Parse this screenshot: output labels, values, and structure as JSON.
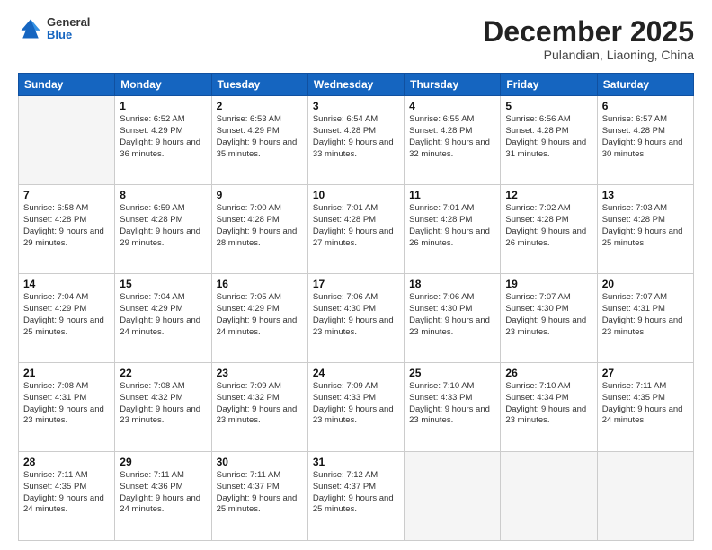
{
  "logo": {
    "general": "General",
    "blue": "Blue"
  },
  "header": {
    "month": "December 2025",
    "location": "Pulandian, Liaoning, China"
  },
  "days_of_week": [
    "Sunday",
    "Monday",
    "Tuesday",
    "Wednesday",
    "Thursday",
    "Friday",
    "Saturday"
  ],
  "weeks": [
    [
      {
        "day": "",
        "empty": true
      },
      {
        "day": "1",
        "sunrise": "6:52 AM",
        "sunset": "4:29 PM",
        "daylight": "9 hours and 36 minutes."
      },
      {
        "day": "2",
        "sunrise": "6:53 AM",
        "sunset": "4:29 PM",
        "daylight": "9 hours and 35 minutes."
      },
      {
        "day": "3",
        "sunrise": "6:54 AM",
        "sunset": "4:28 PM",
        "daylight": "9 hours and 33 minutes."
      },
      {
        "day": "4",
        "sunrise": "6:55 AM",
        "sunset": "4:28 PM",
        "daylight": "9 hours and 32 minutes."
      },
      {
        "day": "5",
        "sunrise": "6:56 AM",
        "sunset": "4:28 PM",
        "daylight": "9 hours and 31 minutes."
      },
      {
        "day": "6",
        "sunrise": "6:57 AM",
        "sunset": "4:28 PM",
        "daylight": "9 hours and 30 minutes."
      }
    ],
    [
      {
        "day": "7",
        "sunrise": "6:58 AM",
        "sunset": "4:28 PM",
        "daylight": "9 hours and 29 minutes."
      },
      {
        "day": "8",
        "sunrise": "6:59 AM",
        "sunset": "4:28 PM",
        "daylight": "9 hours and 29 minutes."
      },
      {
        "day": "9",
        "sunrise": "7:00 AM",
        "sunset": "4:28 PM",
        "daylight": "9 hours and 28 minutes."
      },
      {
        "day": "10",
        "sunrise": "7:01 AM",
        "sunset": "4:28 PM",
        "daylight": "9 hours and 27 minutes."
      },
      {
        "day": "11",
        "sunrise": "7:01 AM",
        "sunset": "4:28 PM",
        "daylight": "9 hours and 26 minutes."
      },
      {
        "day": "12",
        "sunrise": "7:02 AM",
        "sunset": "4:28 PM",
        "daylight": "9 hours and 26 minutes."
      },
      {
        "day": "13",
        "sunrise": "7:03 AM",
        "sunset": "4:28 PM",
        "daylight": "9 hours and 25 minutes."
      }
    ],
    [
      {
        "day": "14",
        "sunrise": "7:04 AM",
        "sunset": "4:29 PM",
        "daylight": "9 hours and 25 minutes."
      },
      {
        "day": "15",
        "sunrise": "7:04 AM",
        "sunset": "4:29 PM",
        "daylight": "9 hours and 24 minutes."
      },
      {
        "day": "16",
        "sunrise": "7:05 AM",
        "sunset": "4:29 PM",
        "daylight": "9 hours and 24 minutes."
      },
      {
        "day": "17",
        "sunrise": "7:06 AM",
        "sunset": "4:30 PM",
        "daylight": "9 hours and 23 minutes."
      },
      {
        "day": "18",
        "sunrise": "7:06 AM",
        "sunset": "4:30 PM",
        "daylight": "9 hours and 23 minutes."
      },
      {
        "day": "19",
        "sunrise": "7:07 AM",
        "sunset": "4:30 PM",
        "daylight": "9 hours and 23 minutes."
      },
      {
        "day": "20",
        "sunrise": "7:07 AM",
        "sunset": "4:31 PM",
        "daylight": "9 hours and 23 minutes."
      }
    ],
    [
      {
        "day": "21",
        "sunrise": "7:08 AM",
        "sunset": "4:31 PM",
        "daylight": "9 hours and 23 minutes."
      },
      {
        "day": "22",
        "sunrise": "7:08 AM",
        "sunset": "4:32 PM",
        "daylight": "9 hours and 23 minutes."
      },
      {
        "day": "23",
        "sunrise": "7:09 AM",
        "sunset": "4:32 PM",
        "daylight": "9 hours and 23 minutes."
      },
      {
        "day": "24",
        "sunrise": "7:09 AM",
        "sunset": "4:33 PM",
        "daylight": "9 hours and 23 minutes."
      },
      {
        "day": "25",
        "sunrise": "7:10 AM",
        "sunset": "4:33 PM",
        "daylight": "9 hours and 23 minutes."
      },
      {
        "day": "26",
        "sunrise": "7:10 AM",
        "sunset": "4:34 PM",
        "daylight": "9 hours and 23 minutes."
      },
      {
        "day": "27",
        "sunrise": "7:11 AM",
        "sunset": "4:35 PM",
        "daylight": "9 hours and 24 minutes."
      }
    ],
    [
      {
        "day": "28",
        "sunrise": "7:11 AM",
        "sunset": "4:35 PM",
        "daylight": "9 hours and 24 minutes."
      },
      {
        "day": "29",
        "sunrise": "7:11 AM",
        "sunset": "4:36 PM",
        "daylight": "9 hours and 24 minutes."
      },
      {
        "day": "30",
        "sunrise": "7:11 AM",
        "sunset": "4:37 PM",
        "daylight": "9 hours and 25 minutes."
      },
      {
        "day": "31",
        "sunrise": "7:12 AM",
        "sunset": "4:37 PM",
        "daylight": "9 hours and 25 minutes."
      },
      {
        "day": "",
        "empty": true
      },
      {
        "day": "",
        "empty": true
      },
      {
        "day": "",
        "empty": true
      }
    ]
  ]
}
